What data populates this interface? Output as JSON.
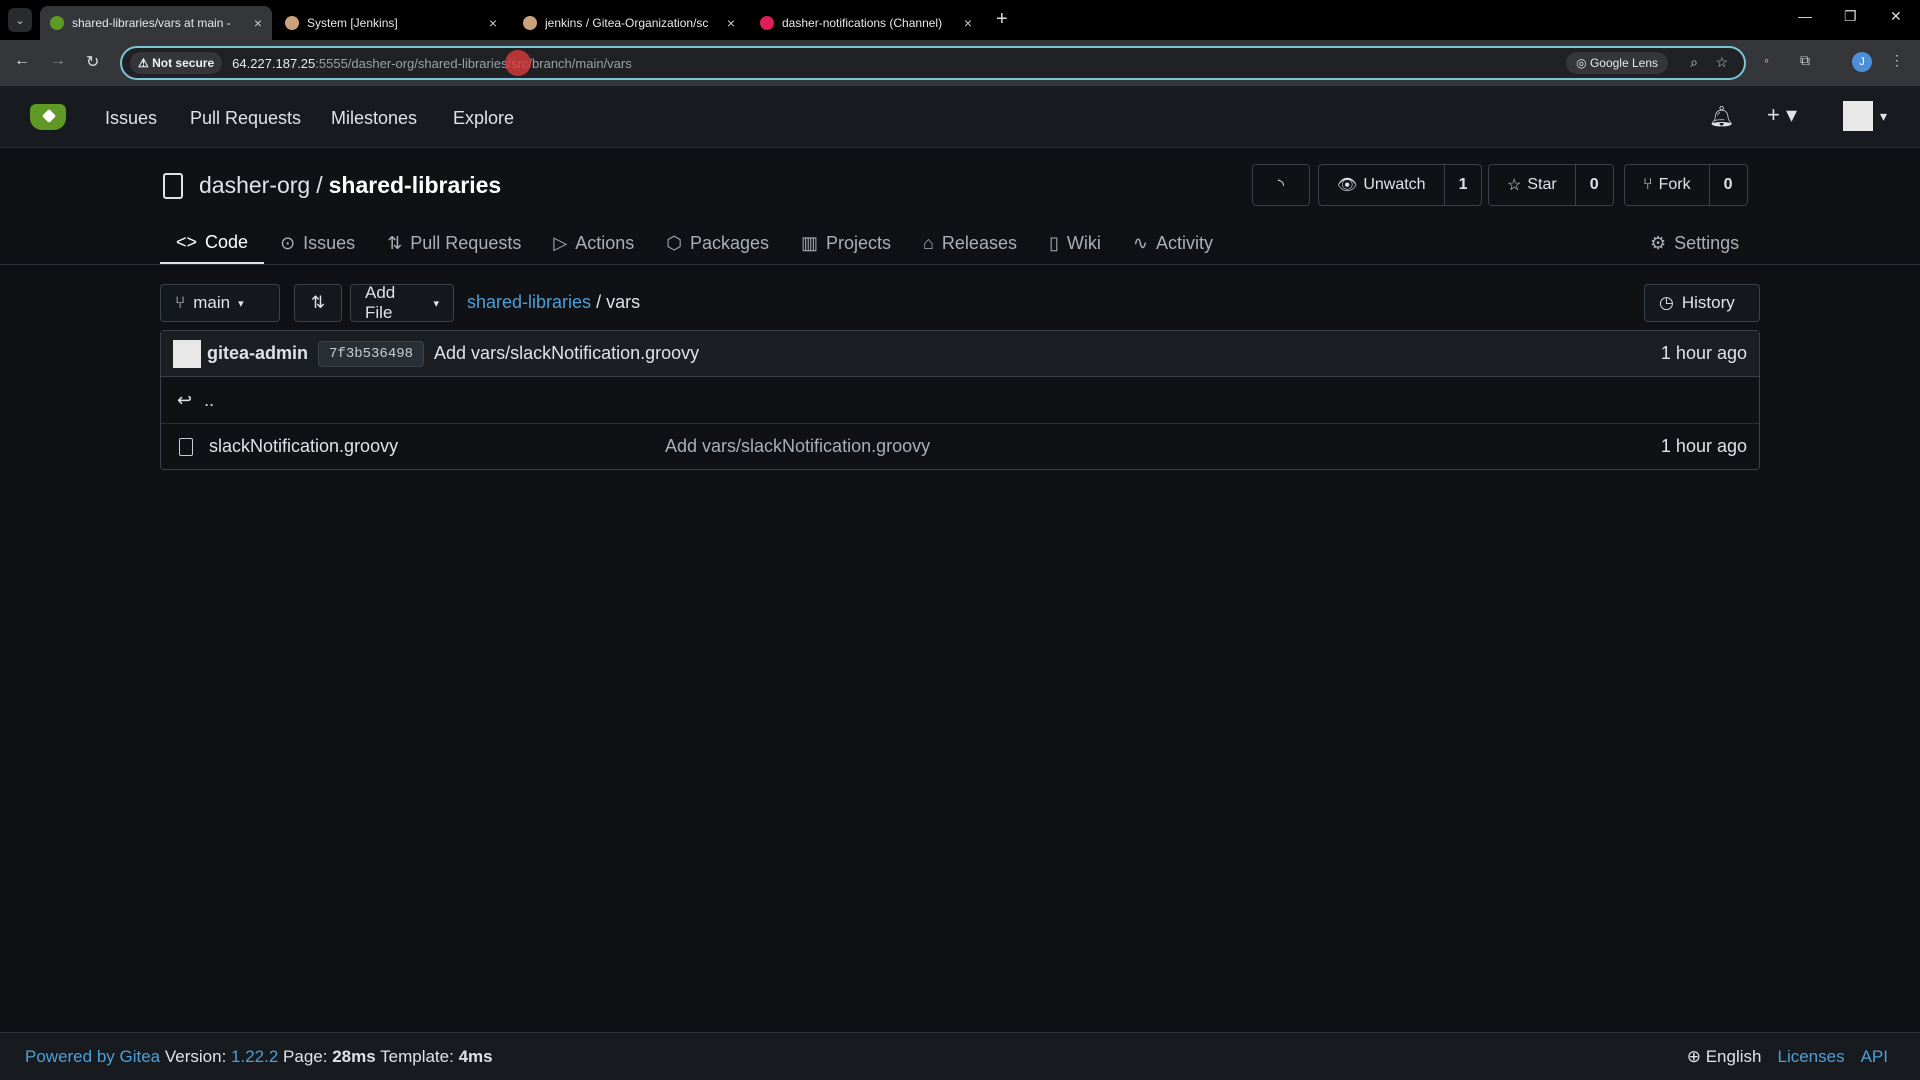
{
  "browser": {
    "tabs": [
      {
        "title": "shared-libraries/vars at main - ",
        "close": "×",
        "fav_color": "#609926",
        "active": true
      },
      {
        "title": "System [Jenkins]",
        "close": "×",
        "fav_color": "#c9a27a",
        "active": false
      },
      {
        "title": "jenkins / Gitea-Organization/sc",
        "close": "×",
        "fav_color": "#c9a27a",
        "active": false
      },
      {
        "title": "dasher-notifications (Channel)",
        "close": "×",
        "fav_color": "#e01e5a",
        "active": false
      }
    ],
    "new_tab": "+",
    "not_secure": "Not secure",
    "url_host": "64.227.187.25",
    "url_rest": ":5555/dasher-org/shared-libraries/src/branch/main/vars",
    "google_lens": "Google Lens",
    "profile_initial": "J"
  },
  "header": {
    "nav": [
      "Issues",
      "Pull Requests",
      "Milestones",
      "Explore"
    ]
  },
  "repo": {
    "owner": "dasher-org",
    "separator": "/",
    "name": "shared-libraries",
    "unwatch_label": "Unwatch",
    "watch_count": "1",
    "star_label": "Star",
    "star_count": "0",
    "fork_label": "Fork",
    "fork_count": "0",
    "tabs": [
      "Code",
      "Issues",
      "Pull Requests",
      "Actions",
      "Packages",
      "Projects",
      "Releases",
      "Wiki",
      "Activity"
    ],
    "settings": "Settings"
  },
  "browser_view": {
    "branch": "main",
    "add_file": "Add File",
    "breadcrumb_root": "shared-libraries",
    "breadcrumb_sep": "/",
    "breadcrumb_current": "vars",
    "history": "History",
    "commit": {
      "author": "gitea-admin",
      "sha": "7f3b536498",
      "message": "Add vars/slackNotification.groovy",
      "time": "1 hour ago"
    },
    "parent": "..",
    "files": [
      {
        "name": "slackNotification.groovy",
        "message": "Add vars/slackNotification.groovy",
        "time": "1 hour ago"
      }
    ]
  },
  "footer": {
    "powered": "Powered by Gitea",
    "version_label": "Version:",
    "version": "1.22.2",
    "page_label": "Page:",
    "page_time": "28ms",
    "template_label": "Template:",
    "template_time": "4ms",
    "language": "English",
    "licenses": "Licenses",
    "api": "API"
  }
}
